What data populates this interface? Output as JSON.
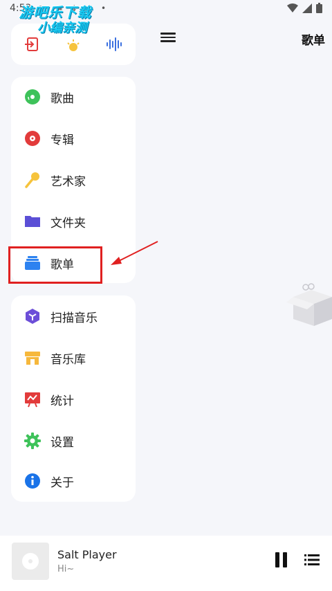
{
  "status_bar": {
    "time": "4:53",
    "left_icons": "▣ ▦ ↓ ↓ •"
  },
  "watermark": {
    "line1": "游吧乐下载",
    "line2": "小编亲测"
  },
  "header": {
    "title": "歌单"
  },
  "top_toolbar": {
    "icons": [
      "exit-icon",
      "sun-icon",
      "waveform-icon"
    ],
    "colors": {
      "exit": "#e23b3b",
      "sun": "#f6c33c",
      "wave": "#3a6fe0"
    }
  },
  "nav_primary": [
    {
      "label": "歌曲",
      "icon": "music-disc-icon",
      "color": "#3ec25a"
    },
    {
      "label": "专辑",
      "icon": "album-icon",
      "color": "#e23b3b"
    },
    {
      "label": "艺术家",
      "icon": "microphone-icon",
      "color": "#f6c33c"
    },
    {
      "label": "文件夹",
      "icon": "folder-icon",
      "color": "#5b4fd6"
    },
    {
      "label": "歌单",
      "icon": "playlist-icon",
      "color": "#2d82f0"
    }
  ],
  "nav_secondary": [
    {
      "label": "扫描音乐",
      "icon": "scan-icon",
      "color": "#6c4ed8"
    },
    {
      "label": "音乐库",
      "icon": "store-icon",
      "color": "#f6b83c"
    },
    {
      "label": "统计",
      "icon": "chart-icon",
      "color": "#e23b3b"
    },
    {
      "label": "设置",
      "icon": "gear-icon",
      "color": "#3ec25a"
    },
    {
      "label": "关于",
      "icon": "info-icon",
      "color": "#1a73e8"
    }
  ],
  "player": {
    "title": "Salt Player",
    "subtitle": "Hi~"
  }
}
